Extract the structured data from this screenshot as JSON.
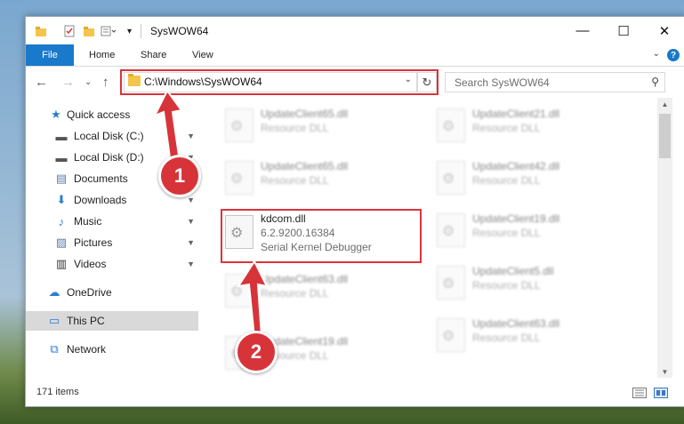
{
  "window": {
    "title": "SysWOW64",
    "controls": {
      "minimize": "—",
      "maximize": "☐",
      "close": "✕"
    }
  },
  "ribbon": {
    "file": "File",
    "tabs": [
      "Home",
      "Share",
      "View"
    ],
    "help": "?",
    "expander": "⌄"
  },
  "nav": {
    "back": "←",
    "forward": "→",
    "recent": "⌄",
    "up": "↑",
    "address": "C:\\Windows\\SysWOW64",
    "address_dropdown": "⌄",
    "refresh": "↻",
    "search_placeholder": "Search SysWOW64",
    "search_icon": "magnifier-icon"
  },
  "sidebar": {
    "items": [
      {
        "label": "Quick access",
        "icon": "★",
        "pinned": false
      },
      {
        "label": "Local Disk (C:)",
        "icon": "▬",
        "pinned": true
      },
      {
        "label": "Local Disk (D:)",
        "icon": "▬",
        "pinned": true
      },
      {
        "label": "Documents",
        "icon": "▤",
        "pinned": true
      },
      {
        "label": "Downloads",
        "icon": "⬇",
        "pinned": true
      },
      {
        "label": "Music",
        "icon": "♪",
        "pinned": true
      },
      {
        "label": "Pictures",
        "icon": "▨",
        "pinned": true
      },
      {
        "label": "Videos",
        "icon": "▥",
        "pinned": true
      },
      {
        "label": "OneDrive",
        "icon": "☁",
        "pinned": false
      },
      {
        "label": "This PC",
        "icon": "▭",
        "pinned": false,
        "selected": true
      },
      {
        "label": "Network",
        "icon": "⧉",
        "pinned": false
      }
    ],
    "pin_glyph": "📌"
  },
  "files": {
    "left_column": [
      {
        "name": "UpdateClient65.dll",
        "type": "Resource DLL"
      },
      {
        "name": "UpdateClient65.dll",
        "type": "Resource DLL"
      },
      {
        "name": "kdcom.dll",
        "version": "6.2.9200.16384",
        "type": "Serial Kernel Debugger",
        "highlighted": true
      },
      {
        "name": "UpdateClient63.dll",
        "type": "Resource DLL"
      },
      {
        "name": "UpdateClient19.dll",
        "type": "Resource DLL"
      }
    ],
    "right_column": [
      {
        "name": "UpdateClient21.dll",
        "type": "Resource DLL"
      },
      {
        "name": "UpdateClient42.dll",
        "type": "Resource DLL"
      },
      {
        "name": "UpdateClient19.dll",
        "type": "Resource DLL"
      },
      {
        "name": "UpdateClient5.dll",
        "type": "Resource DLL"
      },
      {
        "name": "UpdateClient63.dll",
        "type": "Resource DLL"
      }
    ]
  },
  "status": {
    "count": "171 items"
  },
  "callouts": {
    "one": "1",
    "two": "2",
    "color": "#d7343a"
  },
  "colors": {
    "accent": "#1979ca",
    "highlight": "#d9343a",
    "selected_bg": "#d9d9d9"
  }
}
